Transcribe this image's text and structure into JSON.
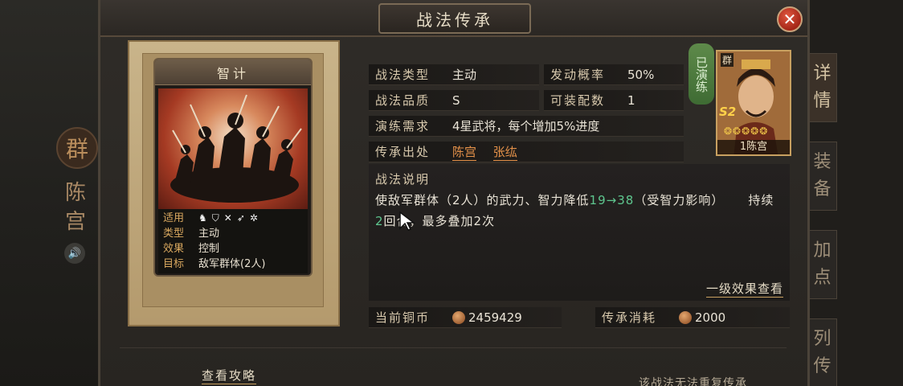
{
  "background": {
    "faction_seal": "群",
    "general_name": "陈宫",
    "sound_icon": "sound-icon",
    "side_tabs": [
      "详情",
      "装备",
      "加点",
      "列传"
    ]
  },
  "dialog": {
    "title": "战法传承",
    "close_icon": "close-icon"
  },
  "card": {
    "title": "智计",
    "apply_label": "适用",
    "apply_icons": [
      "cavalry-icon",
      "shield-icon",
      "bow-icon",
      "spear-icon",
      "wheel-icon"
    ],
    "rows": [
      {
        "key": "类型",
        "value": "主动"
      },
      {
        "key": "效果",
        "value": "控制"
      },
      {
        "key": "目标",
        "value": "敌军群体(2人)"
      }
    ]
  },
  "fields": {
    "type_label": "战法类型",
    "type_value": "主动",
    "rate_label": "发动概率",
    "rate_value": "50%",
    "quality_label": "战法品质",
    "quality_value": "S",
    "slots_label": "可装配数",
    "slots_value": "1",
    "practice_label": "演练需求",
    "practice_value": "4星武将，每个增加5%进度",
    "source_label": "传承出处",
    "source_values": [
      "陈宫",
      "张纮"
    ]
  },
  "portrait": {
    "practiced_badge": "已演练",
    "faction": "群",
    "rank": "S2",
    "stars": "❂❂❂❂❂",
    "caption": "1陈宫"
  },
  "description": {
    "title": "战法说明",
    "text_part1": "使敌军群体（2人）的武力、智力降低",
    "value_from": "19",
    "arrow": "→",
    "value_to": "38",
    "text_part2": "（受智力影响）",
    "text_part3": "持续",
    "duration": "2",
    "text_part4": "回合，最多叠加2次",
    "level_link": "一级效果查看"
  },
  "costs": {
    "copper_label": "当前铜币",
    "copper_value": "2459429",
    "inherit_label": "传承消耗",
    "inherit_value": "2000"
  },
  "footer": {
    "guide_link": "查看攻略",
    "note": "该战法无法重复传承"
  }
}
